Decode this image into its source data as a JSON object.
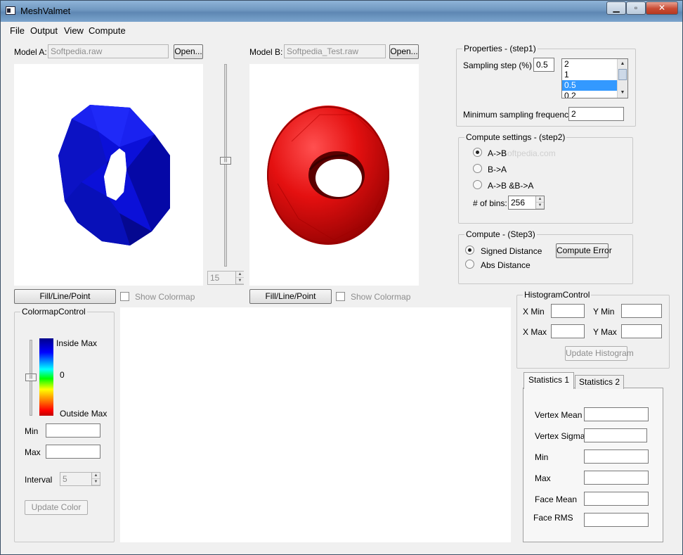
{
  "window": {
    "title": "MeshValmet",
    "min_glyph": "▁",
    "max_glyph": "▫",
    "close_glyph": "✕"
  },
  "menu": [
    "File",
    "Output",
    "View",
    "Compute"
  ],
  "model_a": {
    "label": "Model A:",
    "file": "Softpedia.raw",
    "open_label": "Open..."
  },
  "model_b": {
    "label": "Model B:",
    "file": "Softpedia_Test.raw",
    "open_label": "Open..."
  },
  "mesh_colors": {
    "model_a": "#0b10d8",
    "model_b": "#e41010"
  },
  "center_slider": {
    "value": "15"
  },
  "view_a": {
    "fill_label": "Fill/Line/Point",
    "colormap_label": "Show Colormap"
  },
  "view_b": {
    "fill_label": "Fill/Line/Point",
    "colormap_label": "Show Colormap"
  },
  "properties": {
    "title": "Properties - (step1)",
    "sampling_label": "Sampling step (%)",
    "sampling_value": "0.5",
    "options": [
      "2",
      "1",
      "0.5",
      "0.2"
    ],
    "selected_option": "0.5",
    "min_freq_label": "Minimum sampling frequency",
    "min_freq_value": "2"
  },
  "compute_settings": {
    "title": "Compute settings - (step2)",
    "options": [
      "A->B",
      "B->A",
      "A->B &B->A"
    ],
    "selected": "A->B",
    "bins_label": "# of bins:",
    "bins_value": "256",
    "watermark": "Softpedia.com"
  },
  "compute": {
    "title": "Compute - (Step3)",
    "signed_label": "Signed Distance",
    "abs_label": "Abs Distance",
    "selected": "Signed Distance",
    "compute_button": "Compute Error"
  },
  "colormap": {
    "title": "ColormapControl",
    "inside_max": "Inside Max",
    "zero": "0",
    "outside_max": "Outside Max",
    "min_label": "Min",
    "max_label": "Max",
    "interval_label": "Interval",
    "interval_value": "5",
    "update_button": "Update Color"
  },
  "histogram": {
    "title": "HistogramControl",
    "x_min": "X Min",
    "y_min": "Y Min",
    "x_max": "X Max",
    "y_max": "Y Max",
    "update_button": "Update Histogram"
  },
  "statistics": {
    "tabs": [
      "Statistics 1",
      "Statistics 2"
    ],
    "active_tab": "Statistics 1",
    "fields": [
      "Vertex Mean",
      "Vertex Sigma",
      "Min",
      "Max",
      "Face Mean",
      "Face RMS"
    ]
  }
}
